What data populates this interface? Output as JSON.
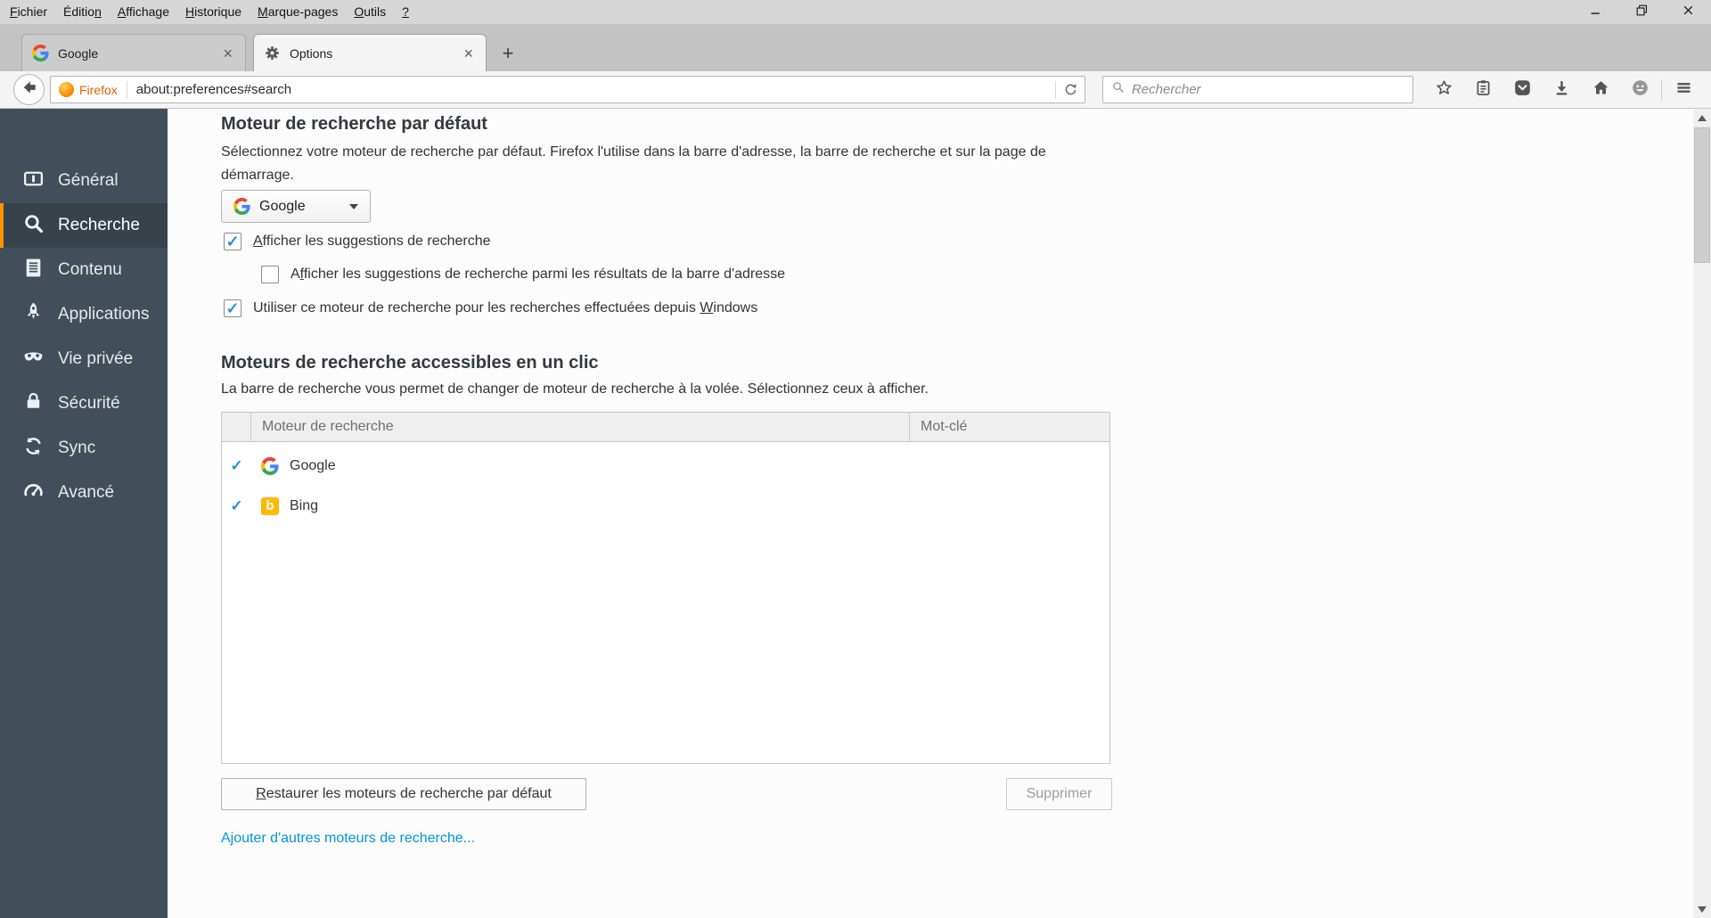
{
  "menu_bar": {
    "items": [
      {
        "name": "fichier",
        "label": "Fichier",
        "u": 0
      },
      {
        "name": "edition",
        "label": "Édition",
        "u": 6
      },
      {
        "name": "affichage",
        "label": "Affichage",
        "u": 0
      },
      {
        "name": "historique",
        "label": "Historique",
        "u": 0
      },
      {
        "name": "marque-pages",
        "label": "Marque-pages",
        "u": 0
      },
      {
        "name": "outils",
        "label": "Outils",
        "u": 0
      },
      {
        "name": "aide",
        "label": "?",
        "u": 0
      }
    ],
    "window_controls": [
      {
        "name": "minimize-button",
        "icon": "minimize"
      },
      {
        "name": "restore-button",
        "icon": "restore"
      },
      {
        "name": "close-button",
        "icon": "closewin"
      }
    ]
  },
  "tabs": {
    "close_glyph": "×",
    "new_tab_label": "+",
    "items": [
      {
        "name": "google",
        "title": "Google",
        "icon": "google-favicon",
        "icon_key": "google",
        "active": false
      },
      {
        "name": "options",
        "title": "Options",
        "icon": "gear-icon",
        "icon_key": "gear",
        "active": true
      }
    ]
  },
  "toolbar": {
    "url": "about:preferences#search",
    "firefox_badge": "Firefox",
    "search_placeholder": "Rechercher",
    "buttons": [
      {
        "name": "bookmark-star-button",
        "icon": "star"
      },
      {
        "name": "bookmarks-menu-button",
        "icon": "clipboard"
      },
      {
        "name": "pocket-button",
        "icon": "pocket"
      },
      {
        "name": "downloads-button",
        "icon": "download"
      },
      {
        "name": "home-button",
        "icon": "home"
      },
      {
        "name": "hello-button",
        "icon": "smiley"
      }
    ]
  },
  "sidebar": {
    "items": [
      {
        "name": "general",
        "label": "Général",
        "icon": "side-general",
        "selected": false
      },
      {
        "name": "search",
        "label": "Recherche",
        "icon": "side-search",
        "selected": true
      },
      {
        "name": "content",
        "label": "Contenu",
        "icon": "side-content",
        "selected": false
      },
      {
        "name": "applications",
        "label": "Applications",
        "icon": "side-apps",
        "selected": false
      },
      {
        "name": "privacy",
        "label": "Vie privée",
        "icon": "side-privacy",
        "selected": false
      },
      {
        "name": "security",
        "label": "Sécurité",
        "icon": "side-security",
        "selected": false
      },
      {
        "name": "sync",
        "label": "Sync",
        "icon": "side-sync",
        "selected": false
      },
      {
        "name": "advanced",
        "label": "Avancé",
        "icon": "side-advanced",
        "selected": false
      }
    ]
  },
  "section1": {
    "title": "Moteur de recherche par défaut",
    "description": "Sélectionnez votre moteur de recherche par défaut. Firefox l'utilise dans la barre d'adresse, la barre de recherche et sur la page de démarrage.",
    "engine_value": "Google",
    "checkboxes": [
      {
        "name": "show-search-suggestions",
        "label": "Afficher les suggestions de recherche",
        "u": 0,
        "checked": true,
        "indent": false
      },
      {
        "name": "show-suggestions-in-urlbar",
        "label": "Afficher les suggestions de recherche parmi les résultats de la barre d'adresse",
        "u": 1,
        "checked": false,
        "indent": true
      },
      {
        "name": "use-engine-for-windows-search",
        "label": "Utiliser ce moteur de recherche pour les recherches effectuées depuis Windows",
        "u": 70,
        "checked": true,
        "indent": false
      }
    ]
  },
  "section2": {
    "title": "Moteurs de recherche accessibles en un clic",
    "description": "La barre de recherche vous permet de changer de moteur de recherche à la volée. Sélectionnez ceux à afficher.",
    "table": {
      "headers": [
        "Moteur de recherche",
        "Mot-clé"
      ],
      "rows": [
        {
          "name": "google",
          "label": "Google",
          "icon_key": "google",
          "checked": true,
          "keyword": ""
        },
        {
          "name": "bing",
          "label": "Bing",
          "icon_key": "bing",
          "checked": true,
          "keyword": ""
        }
      ]
    },
    "restore_button": {
      "label": "Restaurer les moteurs de recherche par défaut",
      "u": 0
    },
    "delete_button": {
      "label": "Supprimer",
      "disabled": true
    },
    "add_link": "Ajouter d'autres moteurs de recherche..."
  },
  "glyphs": {
    "check": "✓"
  },
  "colors": {
    "accent_orange": "#ff9400",
    "sidebar_bg": "#424f5a",
    "sidebar_selected_bg": "#38424b",
    "link_blue": "#0095dd",
    "check_blue": "#2094d4",
    "firefox_orange": "#e66000",
    "bing_yellow": "#ffb900"
  }
}
